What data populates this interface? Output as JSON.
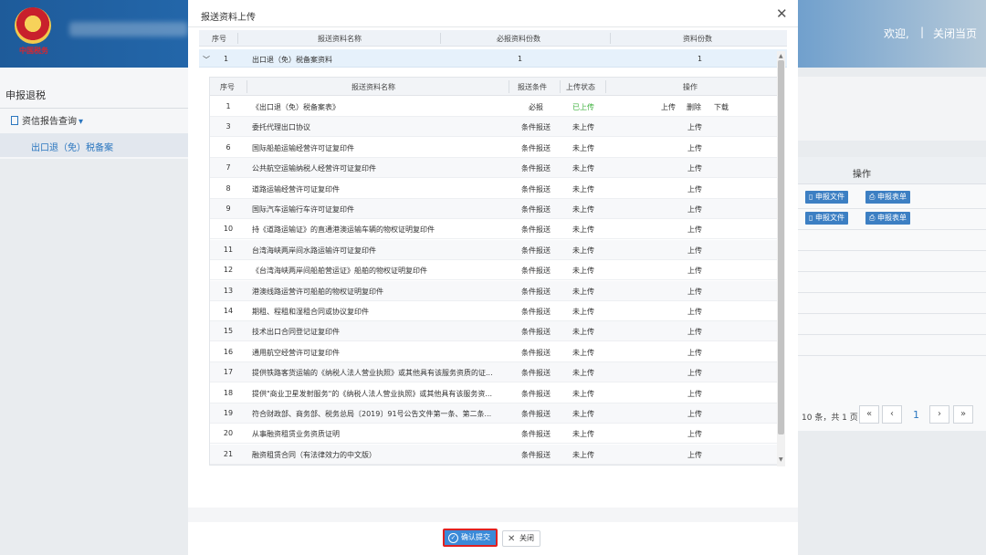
{
  "header": {
    "emblem_text": "中国税务",
    "welcome": "欢迎,",
    "separator": "|",
    "close_page": "关闭当页"
  },
  "sidebar": {
    "section_title": "申报退税",
    "menu_label": "资信报告查询",
    "active_item": "出口退（免）税备案"
  },
  "background_table": {
    "operation_header": "操作",
    "button_file": "申报文件",
    "button_form": "申报表单",
    "pager_text": "10 条，共 1 页",
    "page_number": "1"
  },
  "modal": {
    "title": "报送资料上传",
    "outer_headers": [
      "序号",
      "报送资料名称",
      "必报资料份数",
      "资料份数"
    ],
    "outer_row": {
      "seq": "1",
      "name": "出口退（免）税备案资料",
      "required": "1",
      "count": "1"
    },
    "inner_headers": [
      "序号",
      "报送资料名称",
      "报送条件",
      "上传状态",
      "操作"
    ],
    "actions": {
      "upload": "上传",
      "delete": "删除",
      "download": "下载"
    },
    "rows": [
      {
        "seq": "1",
        "name": "《出口退（免）税备案表》",
        "cond": "必报",
        "status": "已上传"
      },
      {
        "seq": "3",
        "name": "委托代理出口协议",
        "cond": "条件报送",
        "status": "未上传"
      },
      {
        "seq": "6",
        "name": "国际船舶运输经营许可证复印件",
        "cond": "条件报送",
        "status": "未上传"
      },
      {
        "seq": "7",
        "name": "公共航空运输纳税人经营许可证复印件",
        "cond": "条件报送",
        "status": "未上传"
      },
      {
        "seq": "8",
        "name": "道路运输经营许可证复印件",
        "cond": "条件报送",
        "status": "未上传"
      },
      {
        "seq": "9",
        "name": "国际汽车运输行车许可证复印件",
        "cond": "条件报送",
        "status": "未上传"
      },
      {
        "seq": "10",
        "name": "持《道路运输证》的直通港澳运输车辆的物权证明复印件",
        "cond": "条件报送",
        "status": "未上传"
      },
      {
        "seq": "11",
        "name": "台湾海峡两岸间水路运输许可证复印件",
        "cond": "条件报送",
        "status": "未上传"
      },
      {
        "seq": "12",
        "name": "《台湾海峡两岸间船舶营运证》船舶的物权证明复印件",
        "cond": "条件报送",
        "status": "未上传"
      },
      {
        "seq": "13",
        "name": "港澳线路运营许可船舶的物权证明复印件",
        "cond": "条件报送",
        "status": "未上传"
      },
      {
        "seq": "14",
        "name": "期租、程租和湿租合同或协议复印件",
        "cond": "条件报送",
        "status": "未上传"
      },
      {
        "seq": "15",
        "name": "技术出口合同登记证复印件",
        "cond": "条件报送",
        "status": "未上传"
      },
      {
        "seq": "16",
        "name": "通用航空经营许可证复印件",
        "cond": "条件报送",
        "status": "未上传"
      },
      {
        "seq": "17",
        "name": "提供铁路客货运输的《纳税人法人营业执照》或其他具有该服务资质的证...",
        "cond": "条件报送",
        "status": "未上传"
      },
      {
        "seq": "18",
        "name": "提供\"商业卫星发射服务\"的《纳税人法人营业执照》或其他具有该服务资...",
        "cond": "条件报送",
        "status": "未上传"
      },
      {
        "seq": "19",
        "name": "符合财政部、商务部、税务总局〔2019〕91号公告文件第一条、第二条...",
        "cond": "条件报送",
        "status": "未上传"
      },
      {
        "seq": "20",
        "name": "从事融资租赁业务资质证明",
        "cond": "条件报送",
        "status": "未上传"
      },
      {
        "seq": "21",
        "name": "融资租赁合同（有法律效力的中文版）",
        "cond": "条件报送",
        "status": "未上传"
      }
    ],
    "confirm_label": "确认提交",
    "close_label": "关闭"
  },
  "colors": {
    "accent": "#3b8ad8",
    "uploaded": "#3fb23f",
    "highlight_border": "#e02020"
  }
}
